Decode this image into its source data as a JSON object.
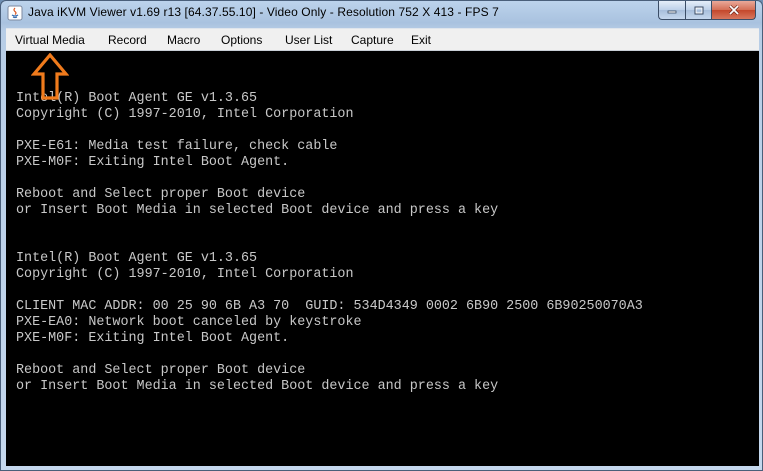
{
  "window": {
    "title": "Java iKVM Viewer v1.69 r13 [64.37.55.10]  - Video Only - Resolution 752 X 413 - FPS 7",
    "icon": "java-icon",
    "controls": [
      "minimize-icon",
      "maximize-icon",
      "close-icon"
    ]
  },
  "menu": {
    "items": [
      {
        "label": "Virtual Media"
      },
      {
        "label": "Record"
      },
      {
        "label": "Macro"
      },
      {
        "label": "Options"
      },
      {
        "label": "User List"
      },
      {
        "label": "Capture"
      },
      {
        "label": "Exit"
      }
    ]
  },
  "annotation": {
    "icon": "up-arrow-icon",
    "color": "#f07b1c"
  },
  "console": {
    "text_color": "#c8c8c8",
    "background": "#000000",
    "lines": [
      "Intel(R) Boot Agent GE v1.3.65",
      "Copyright (C) 1997-2010, Intel Corporation",
      "PXE-E61: Media test failure, check cable",
      "PXE-M0F: Exiting Intel Boot Agent.",
      "Reboot and Select proper Boot device",
      "or Insert Boot Media in selected Boot device and press a key",
      "Intel(R) Boot Agent GE v1.3.65",
      "Copyright (C) 1997-2010, Intel Corporation",
      "CLIENT MAC ADDR: 00 25 90 6B A3 70  GUID: 534D4349 0002 6B90 2500 6B90250070A3",
      "PXE-EA0: Network boot canceled by keystroke",
      "PXE-M0F: Exiting Intel Boot Agent.",
      "Reboot and Select proper Boot device",
      "or Insert Boot Media in selected Boot device and press a key"
    ]
  }
}
